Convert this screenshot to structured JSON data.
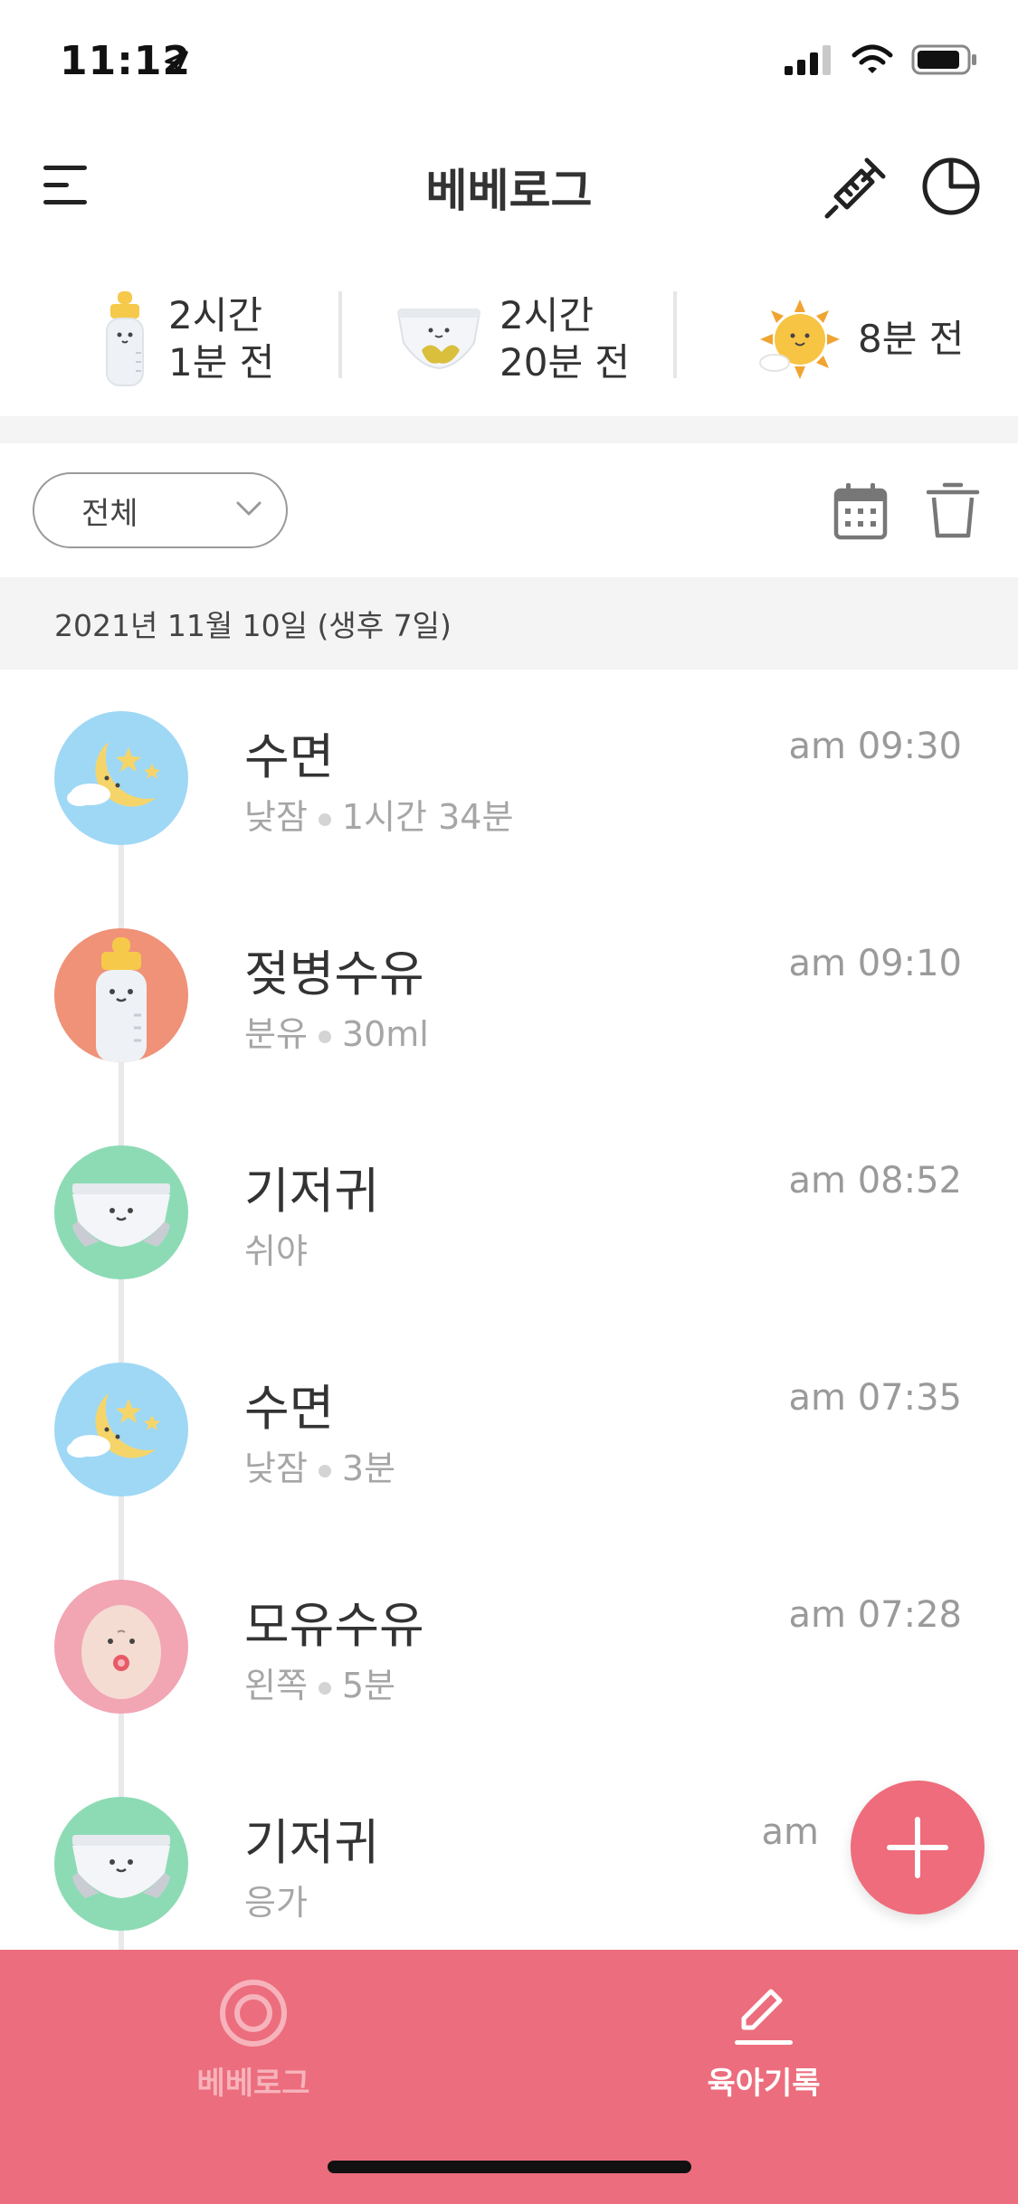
{
  "status_bar": {
    "time": "11:12",
    "icons": [
      "location-arrow-icon",
      "signal-icon",
      "wifi-icon",
      "battery-icon"
    ]
  },
  "app_bar": {
    "title": "베베로그",
    "icons": [
      "menu-icon",
      "syringe-icon",
      "pie-chart-icon"
    ]
  },
  "summary": [
    {
      "icon": "bottle-icon",
      "line1": "2시간",
      "line2": "1분 전"
    },
    {
      "icon": "diaper-icon",
      "line1": "2시간",
      "line2": "20분 전"
    },
    {
      "icon": "sun-icon",
      "line1": "8분 전"
    }
  ],
  "filter": {
    "selected": "전체"
  },
  "date_header": "2021년 11월 10일 (생후 7일)",
  "records": [
    {
      "icon": "sleep-moon-icon",
      "title": "수면",
      "sub1": "낮잠",
      "sub2": "1시간 34분",
      "time": "am 09:30"
    },
    {
      "icon": "bottle-icon",
      "title": "젖병수유",
      "sub1": "분유",
      "sub2": "30ml",
      "time": "am 09:10"
    },
    {
      "icon": "diaper-icon",
      "title": "기저귀",
      "sub1": "쉬야",
      "sub2": "",
      "time": "am 08:52"
    },
    {
      "icon": "sleep-moon-icon",
      "title": "수면",
      "sub1": "낮잠",
      "sub2": "3분",
      "time": "am 07:35"
    },
    {
      "icon": "breastfeeding-icon",
      "title": "모유수유",
      "sub1": "왼쪽",
      "sub2": "5분",
      "time": "am 07:28"
    },
    {
      "icon": "diaper-icon",
      "title": "기저귀",
      "sub1": "응가",
      "sub2": "",
      "time": "am"
    }
  ],
  "bottom_nav": [
    {
      "label": "베베로그",
      "icon": "target-icon",
      "active": false
    },
    {
      "label": "육아기록",
      "icon": "pencil-icon",
      "active": true
    }
  ],
  "colors": {
    "accent": "#ec6d7d",
    "sleep_bg": "#9fd8f5",
    "bottle_bg": "#ef9278",
    "diaper_bg": "#8ddbb5",
    "breast_bg": "#f2a5b3"
  }
}
